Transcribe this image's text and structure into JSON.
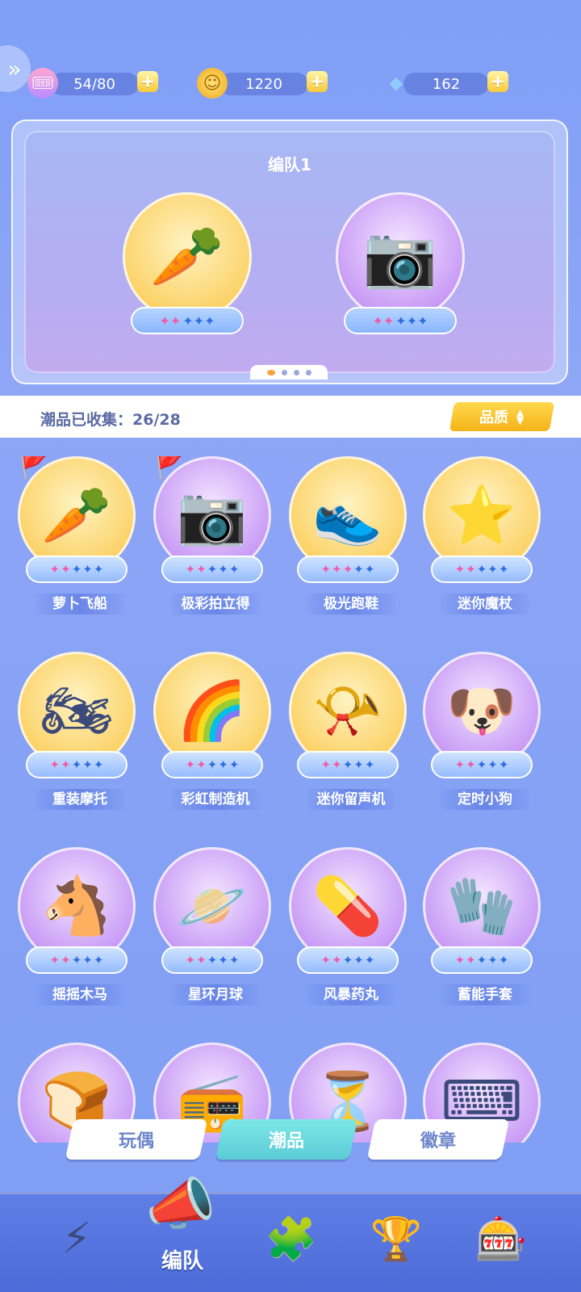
{
  "resources": {
    "tickets": {
      "value": "54/80",
      "icon": "ticket-icon"
    },
    "coins": {
      "value": "1220",
      "icon": "coin-icon"
    },
    "gems": {
      "value": "162",
      "icon": "crystal-icon"
    },
    "plus": "+"
  },
  "team": {
    "title": "编队1",
    "slots": [
      {
        "name": "萝卜飞船",
        "stars": 2,
        "max_stars": 5,
        "icon": "carrot-ship-icon"
      },
      {
        "name": "极彩拍立得",
        "stars": 2,
        "max_stars": 5,
        "icon": "instant-camera-icon"
      }
    ],
    "page_count": 4,
    "current_page": 1
  },
  "collection": {
    "label": "潮品已收集：26/28",
    "sort_button": "品质"
  },
  "items": [
    {
      "name": "萝卜飞船",
      "stars": 2,
      "bg": "gold",
      "glyph": "🥕",
      "flag": true
    },
    {
      "name": "极彩拍立得",
      "stars": 2,
      "bg": "purple",
      "glyph": "📷",
      "flag": true
    },
    {
      "name": "极光跑鞋",
      "stars": 3,
      "bg": "gold",
      "glyph": "👟",
      "flag": false
    },
    {
      "name": "迷你魔杖",
      "stars": 2,
      "bg": "gold",
      "glyph": "⭐",
      "flag": false
    },
    {
      "name": "重装摩托",
      "stars": 2,
      "bg": "gold",
      "glyph": "🏍",
      "flag": false
    },
    {
      "name": "彩虹制造机",
      "stars": 2,
      "bg": "gold",
      "glyph": "🌈",
      "flag": false
    },
    {
      "name": "迷你留声机",
      "stars": 2,
      "bg": "gold",
      "glyph": "📯",
      "flag": false
    },
    {
      "name": "定时小狗",
      "stars": 2,
      "bg": "purple",
      "glyph": "🐶",
      "flag": false
    },
    {
      "name": "摇摇木马",
      "stars": 2,
      "bg": "purple",
      "glyph": "🐴",
      "flag": false
    },
    {
      "name": "星环月球",
      "stars": 2,
      "bg": "purple",
      "glyph": "🪐",
      "flag": false
    },
    {
      "name": "风暴药丸",
      "stars": 2,
      "bg": "purple",
      "glyph": "💊",
      "flag": false
    },
    {
      "name": "蓄能手套",
      "stars": 2,
      "bg": "purple",
      "glyph": "🧤",
      "flag": false
    },
    {
      "name": "",
      "stars": 0,
      "bg": "purple",
      "glyph": "🍞",
      "flag": false
    },
    {
      "name": "",
      "stars": 0,
      "bg": "purple",
      "glyph": "📻",
      "flag": false
    },
    {
      "name": "",
      "stars": 0,
      "bg": "purple",
      "glyph": "⏳",
      "flag": false
    },
    {
      "name": "",
      "stars": 0,
      "bg": "purple",
      "glyph": "⌨",
      "flag": false
    }
  ],
  "tabs": [
    {
      "label": "玩偶",
      "active": false
    },
    {
      "label": "潮品",
      "active": true
    },
    {
      "label": "徽章",
      "active": false
    }
  ],
  "nav": {
    "center_label": "编队",
    "icons": [
      "bolt-badge-icon",
      "whistle-icon",
      "puzzle-icon",
      "trophy-icon",
      "gacha-machine-icon"
    ]
  }
}
